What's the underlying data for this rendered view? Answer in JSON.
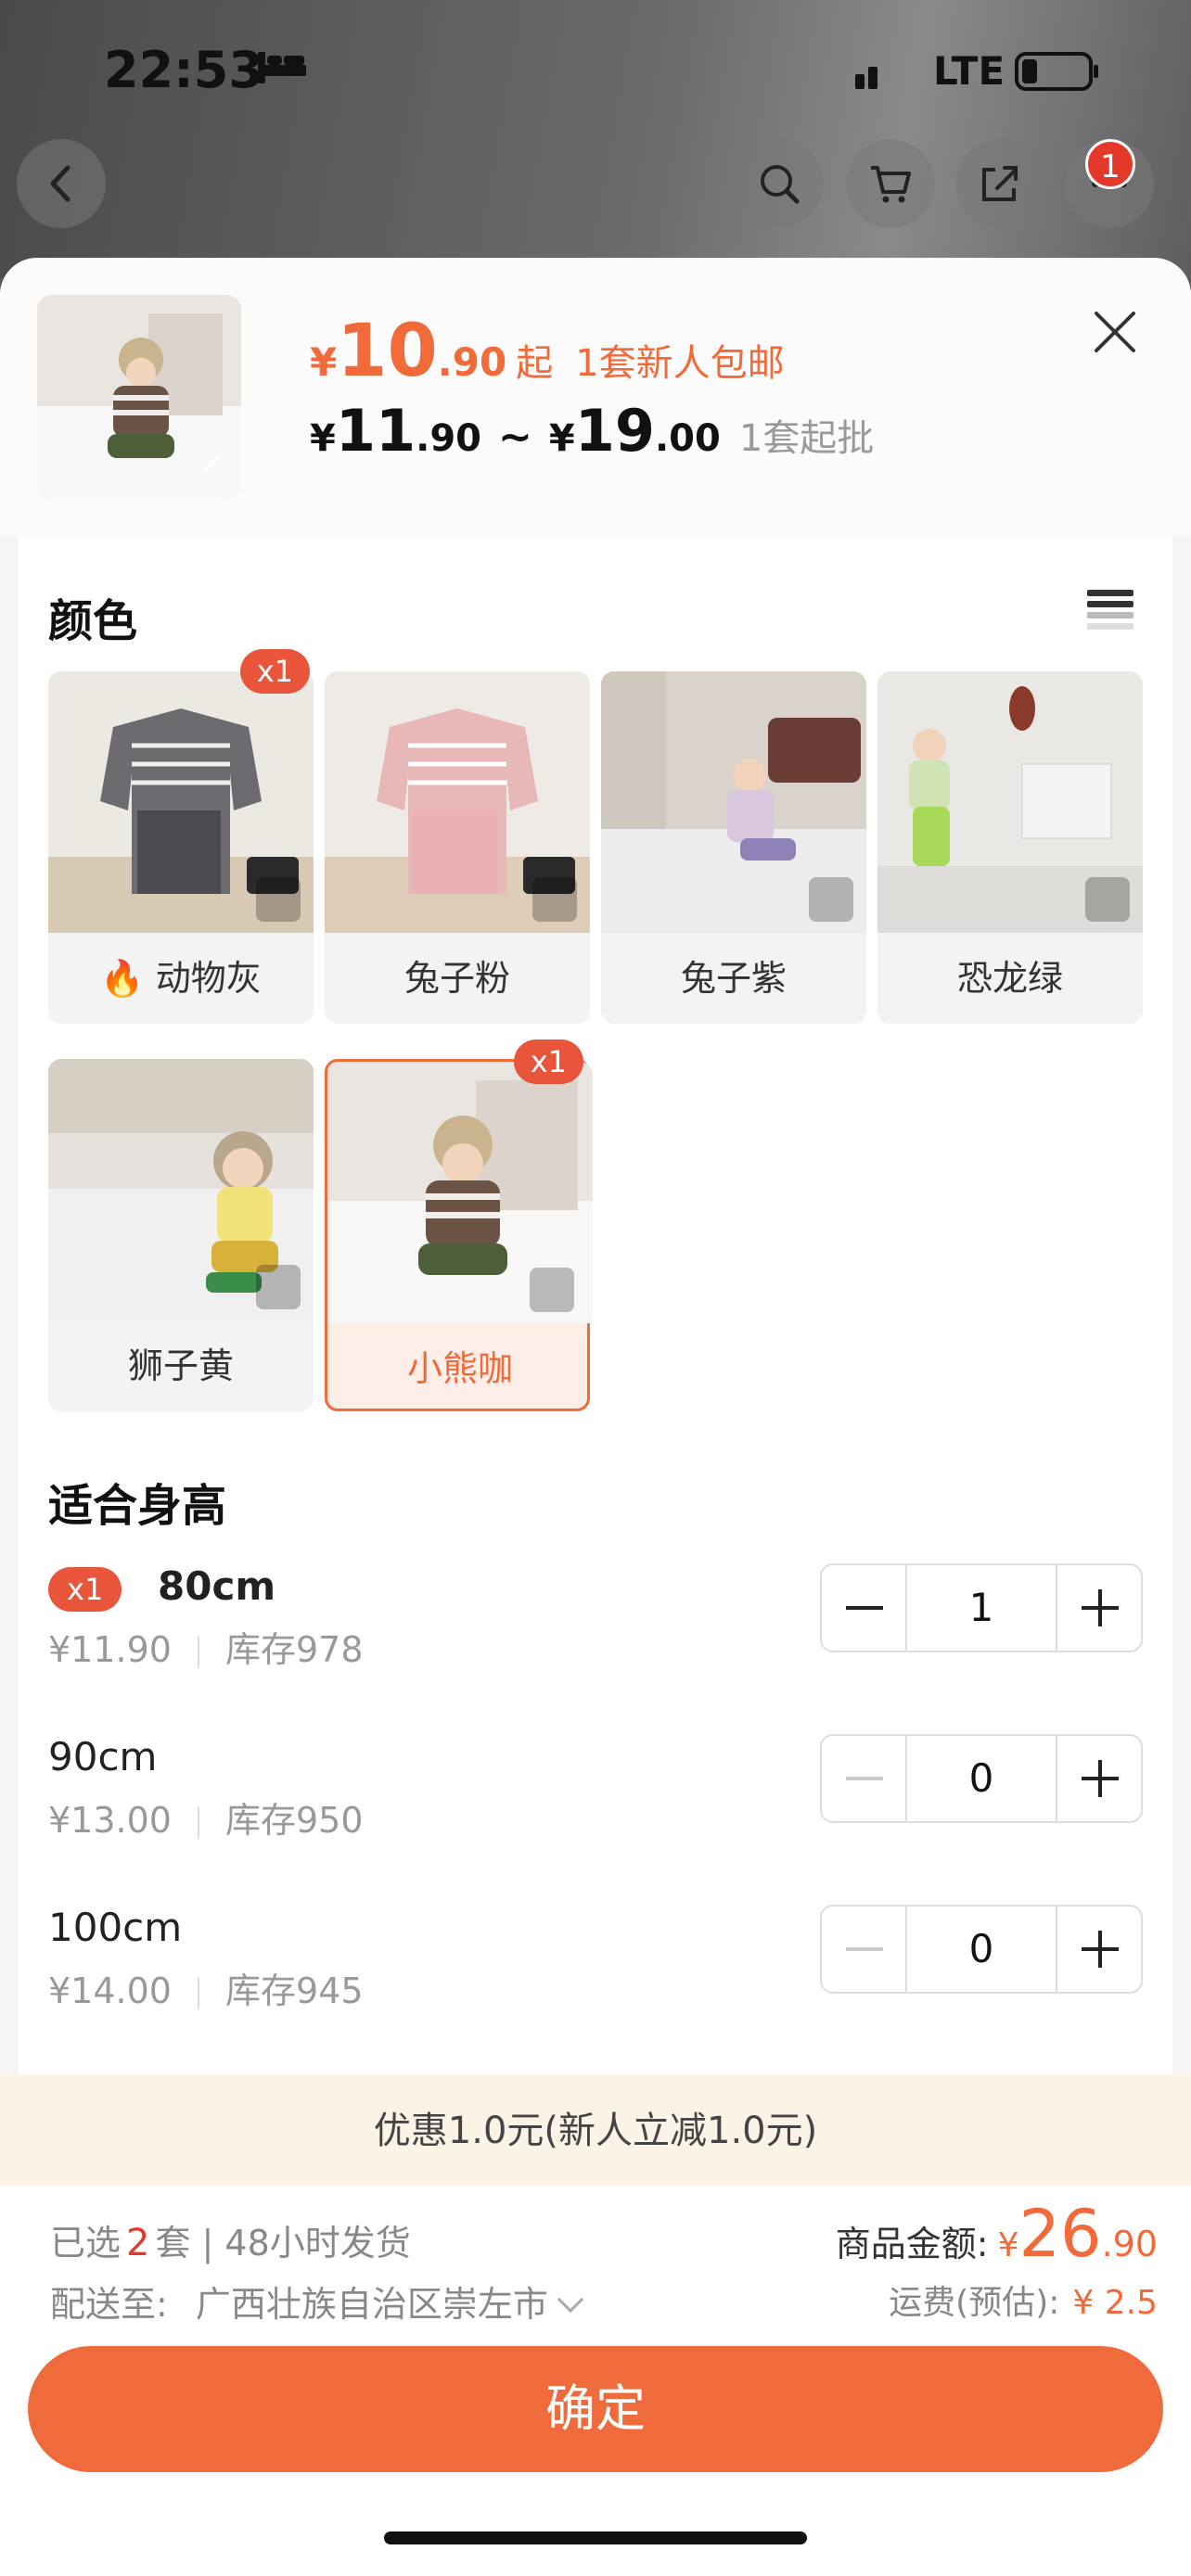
{
  "status_bar": {
    "time": "22:53",
    "network": "LTE"
  },
  "nav": {
    "cart_badge": "1"
  },
  "header": {
    "price_main_yen": "¥",
    "price_main_int": "10",
    "price_main_dec": ".90",
    "price_main_suffix": "起",
    "promo": "1套新人包邮",
    "range_low_yen": "¥",
    "range_low_int": "11",
    "range_low_dec": ".90",
    "range_sep": "~",
    "range_high_yen": "¥",
    "range_high_int": "19",
    "range_high_dec": ".00",
    "min_order": "1套起批"
  },
  "colors": {
    "title": "颜色",
    "items": [
      {
        "label": "动物灰",
        "badge": "x1",
        "hot": true
      },
      {
        "label": "兔子粉"
      },
      {
        "label": "兔子紫"
      },
      {
        "label": "恐龙绿"
      },
      {
        "label": "狮子黄"
      },
      {
        "label": "小熊咖",
        "badge": "x1",
        "selected": true
      }
    ]
  },
  "sizes": {
    "title": "适合身高",
    "items": [
      {
        "badge": "x1",
        "name": "80cm",
        "price": "¥11.90",
        "stock": "库存978",
        "qty": "1"
      },
      {
        "name": "90cm",
        "price": "¥13.00",
        "stock": "库存950",
        "qty": "0"
      },
      {
        "name": "100cm",
        "price": "¥14.00",
        "stock": "库存945",
        "qty": "0"
      }
    ]
  },
  "discount": "优惠1.0元(新人立减1.0元)",
  "summary": {
    "selected_prefix": "已选",
    "selected_count": "2",
    "selected_suffix": "套 | 48小时发货",
    "ship_to_label": "配送至:",
    "ship_to_address": "广西壮族自治区崇左市",
    "amount_label": "商品金额:",
    "amount_yen": "¥",
    "amount_int": "26",
    "amount_dec": ".90",
    "freight_label": "运费(预估):",
    "freight_value": "¥ 2.5"
  },
  "confirm_label": "确定",
  "colors_palette": {
    "accent": "#ef6b3c",
    "badge": "#e8553a",
    "discount_bg": "#fbf3e6"
  }
}
